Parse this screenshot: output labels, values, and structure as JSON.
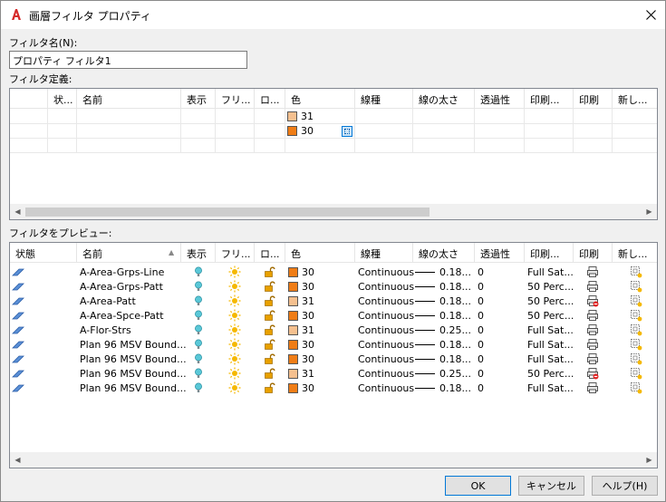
{
  "window": {
    "title": "画層フィルタ プロパティ",
    "close_glyph": "✕"
  },
  "filter_name": {
    "label": "フィルタ名(N):",
    "value": "プロパティ フィルタ1"
  },
  "definition": {
    "label": "フィルタ定義:",
    "columns": [
      "状...",
      "名前",
      "表示",
      "フリ...",
      "ロ...",
      "色",
      "線種",
      "線の太さ",
      "透過性",
      "印刷...",
      "印刷",
      "新し..."
    ],
    "rows": [
      {
        "color": "31",
        "swatch": "#f5c08f"
      },
      {
        "color": "30",
        "swatch": "#f07d16"
      }
    ]
  },
  "preview": {
    "label": "フィルタをプレビュー:",
    "columns": [
      "状態",
      "名前",
      "表示",
      "フリ...",
      "ロ...",
      "色",
      "線種",
      "線の太さ",
      "透過性",
      "印刷...",
      "印刷",
      "新し..."
    ],
    "rows": [
      {
        "name": "A-Area-Grps-Line",
        "color": "30",
        "swatch": "#f07d16",
        "linetype": "Continuous",
        "lineweight": "0.18...",
        "transparency": "0",
        "plotstyle": "Full Sat...",
        "plot_blocked": false
      },
      {
        "name": "A-Area-Grps-Patt",
        "color": "30",
        "swatch": "#f07d16",
        "linetype": "Continuous",
        "lineweight": "0.18...",
        "transparency": "0",
        "plotstyle": "50 Perc...",
        "plot_blocked": false
      },
      {
        "name": "A-Area-Patt",
        "color": "31",
        "swatch": "#f5c08f",
        "linetype": "Continuous",
        "lineweight": "0.18...",
        "transparency": "0",
        "plotstyle": "50 Perc...",
        "plot_blocked": true
      },
      {
        "name": "A-Area-Spce-Patt",
        "color": "30",
        "swatch": "#f07d16",
        "linetype": "Continuous",
        "lineweight": "0.18...",
        "transparency": "0",
        "plotstyle": "50 Perc...",
        "plot_blocked": false
      },
      {
        "name": "A-Flor-Strs",
        "color": "31",
        "swatch": "#f5c08f",
        "linetype": "Continuous",
        "lineweight": "0.25...",
        "transparency": "0",
        "plotstyle": "Full Sat...",
        "plot_blocked": false
      },
      {
        "name": "Plan 96 MSV Bound...",
        "color": "30",
        "swatch": "#f07d16",
        "linetype": "Continuous",
        "lineweight": "0.18...",
        "transparency": "0",
        "plotstyle": "Full Sat...",
        "plot_blocked": false
      },
      {
        "name": "Plan 96 MSV Bound...",
        "color": "30",
        "swatch": "#f07d16",
        "linetype": "Continuous",
        "lineweight": "0.18...",
        "transparency": "0",
        "plotstyle": "Full Sat...",
        "plot_blocked": false
      },
      {
        "name": "Plan 96 MSV Bound...",
        "color": "31",
        "swatch": "#f5c08f",
        "linetype": "Continuous",
        "lineweight": "0.25...",
        "transparency": "0",
        "plotstyle": "50 Perc...",
        "plot_blocked": true
      },
      {
        "name": "Plan 96 MSV Bound...",
        "color": "30",
        "swatch": "#f07d16",
        "linetype": "Continuous",
        "lineweight": "0.18...",
        "transparency": "0",
        "plotstyle": "Full Sat...",
        "plot_blocked": false
      }
    ]
  },
  "buttons": {
    "ok": "OK",
    "cancel": "キャンセル",
    "help": "ヘルプ(H)"
  },
  "icons": {
    "app": "autocad-logo-icon",
    "status": "layer-status-icon",
    "on": "lightbulb-on-icon",
    "freeze": "sun-thawed-icon",
    "lock": "unlocked-padlock-icon",
    "plot": "printer-icon",
    "newvp": "new-viewport-freeze-icon"
  },
  "colors": {
    "accent": "#0078d7",
    "bulb": "#5ac8d8",
    "sun": "#f5b800",
    "lock": "#e8a000",
    "app_red": "#d52a2a"
  }
}
